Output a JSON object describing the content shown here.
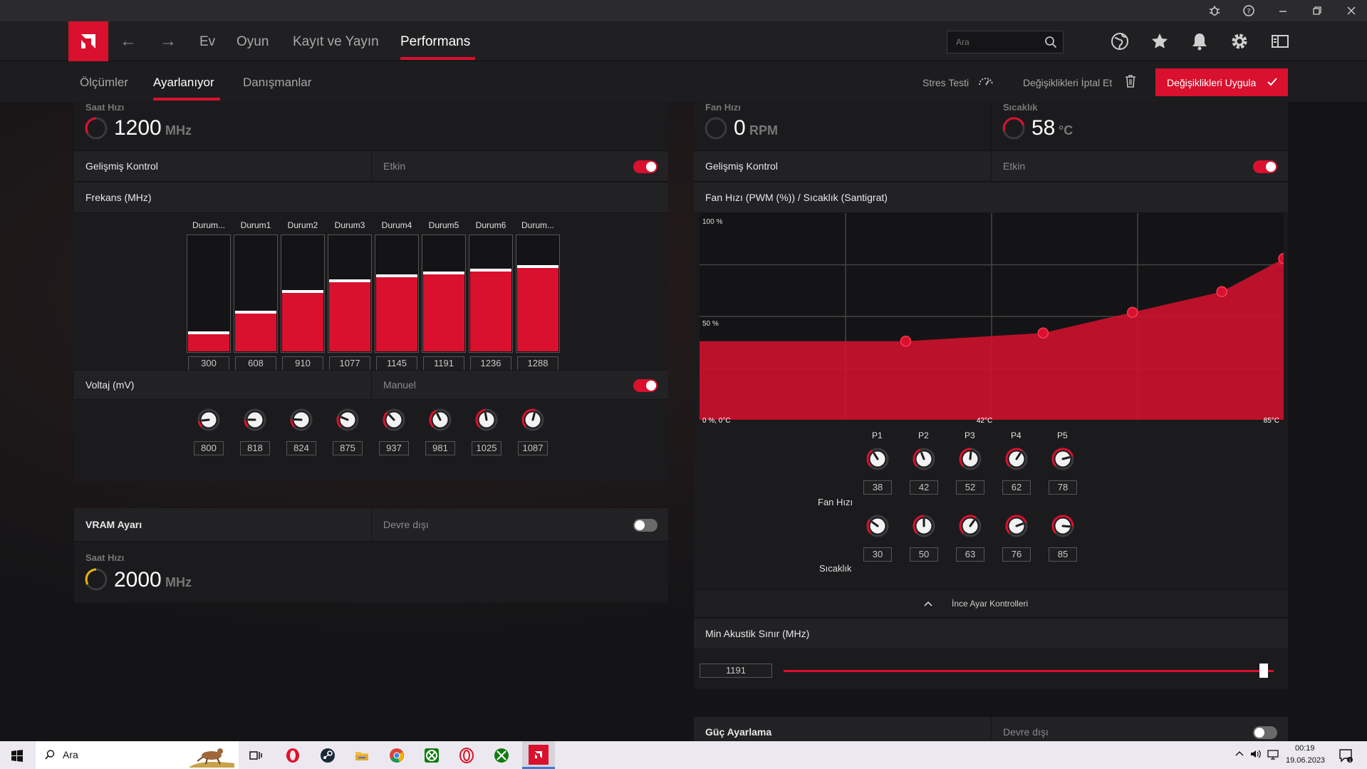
{
  "title_bar": {
    "icons": [
      "bug-icon",
      "help-icon",
      "minimize-icon",
      "restore-icon",
      "close-icon"
    ]
  },
  "nav": {
    "items": [
      "Ev",
      "Oyun",
      "Kayıt ve Yayın",
      "Performans"
    ],
    "active": "Performans",
    "search_placeholder": "Ara",
    "icons": [
      "globe-icon",
      "star-icon",
      "bell-icon",
      "gear-icon",
      "sidebar-icon"
    ]
  },
  "subnav": {
    "tabs": [
      "Ölçümler",
      "Ayarlanıyor",
      "Danışmanlar"
    ],
    "active": "Ayarlanıyor",
    "stress_test": "Stres Testi",
    "discard": "Değişiklikleri İptal Et",
    "apply": "Değişiklikleri Uygula"
  },
  "gpu": {
    "clock": {
      "title": "Saat Hızı",
      "value": "1200",
      "unit": "MHz"
    },
    "advanced_control": {
      "label": "Gelişmiş Kontrol",
      "value": "Etkin",
      "enabled": true
    },
    "frequency": {
      "label": "Frekans (MHz)",
      "states": [
        "Durum...",
        "Durum1",
        "Durum2",
        "Durum3",
        "Durum4",
        "Durum5",
        "Durum6",
        "Durum..."
      ],
      "values": [
        "300",
        "608",
        "910",
        "1077",
        "1145",
        "1191",
        "1236",
        "1288"
      ]
    },
    "voltage": {
      "label": "Voltaj (mV)",
      "mode": "Manuel",
      "enabled": true,
      "values": [
        "800",
        "818",
        "824",
        "875",
        "937",
        "981",
        "1025",
        "1087"
      ]
    }
  },
  "vram": {
    "label": "VRAM Ayarı",
    "status": "Devre dışı",
    "enabled": false,
    "clock": {
      "title": "Saat Hızı",
      "value": "2000",
      "unit": "MHz"
    }
  },
  "fan": {
    "speed": {
      "title": "Fan Hızı",
      "value": "0",
      "unit": "RPM"
    },
    "temperature": {
      "title": "Sıcaklık",
      "value": "58",
      "unit": "°C"
    },
    "advanced_control": {
      "label": "Gelişmiş Kontrol",
      "value": "Etkin",
      "enabled": true
    },
    "curve_label": "Fan Hızı (PWM (%)) / Sıcaklık (Santigrat)",
    "axis": {
      "y_top": "100 %",
      "y_mid": "50 %",
      "origin": "0 %, 0°C",
      "x_mid": "42°C",
      "x_max": "85°C"
    },
    "points_header": [
      "P1",
      "P2",
      "P3",
      "P4",
      "P5"
    ],
    "fan_speed_label": "Fan Hızı",
    "fan_speed_values": [
      "38",
      "42",
      "52",
      "62",
      "78"
    ],
    "temp_label": "Sıcaklık",
    "temp_values": [
      "30",
      "50",
      "63",
      "76",
      "85"
    ],
    "fine_tune": "İnce Ayar Kontrolleri"
  },
  "chart_data": {
    "type": "area",
    "xlabel": "",
    "ylabel": "",
    "xlim": [
      0,
      85
    ],
    "ylim": [
      0,
      100
    ],
    "series": [
      {
        "x": [
          0,
          30,
          50,
          63,
          76,
          85
        ],
        "y": [
          38,
          38,
          42,
          52,
          62,
          78
        ]
      }
    ],
    "color": "#d9102e"
  },
  "acoustic": {
    "label": "Min Akustik Sınır (MHz)",
    "value": "1191",
    "fraction": 0.98
  },
  "power": {
    "label": "Güç Ayarlama",
    "status": "Devre dışı",
    "enabled": false
  },
  "taskbar": {
    "search": "Ara",
    "time": "00:19",
    "date": "19.06.2023"
  }
}
